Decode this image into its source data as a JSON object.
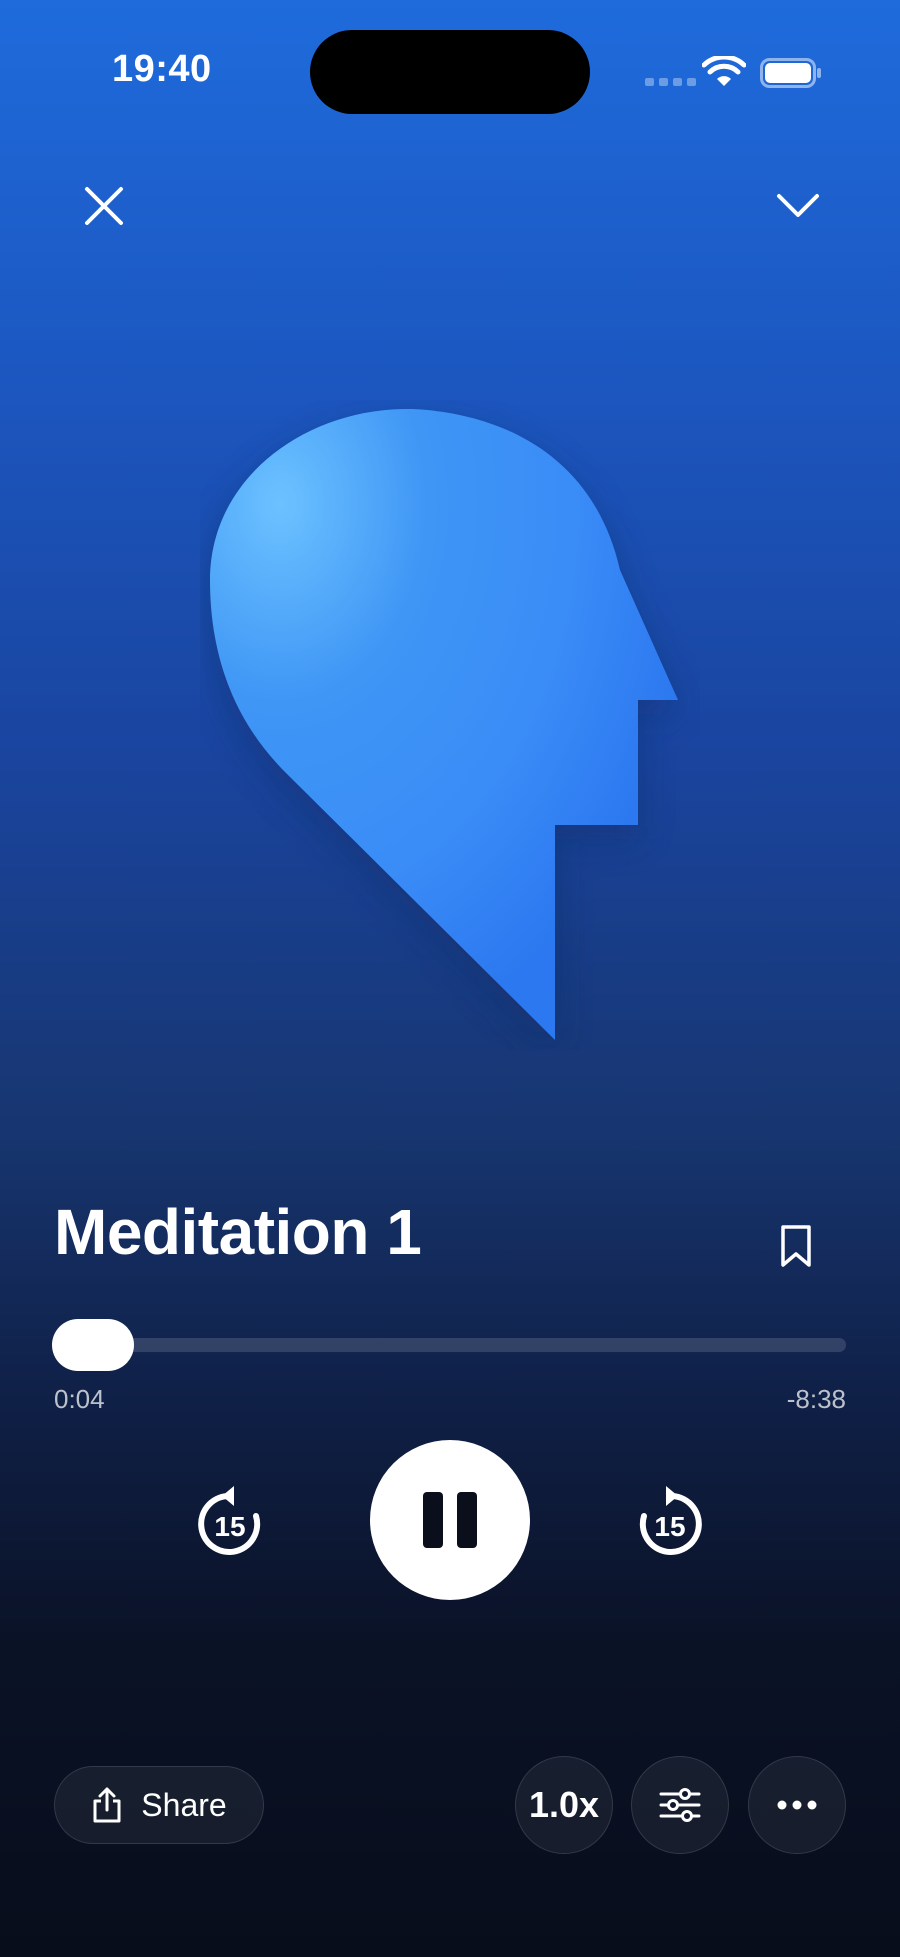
{
  "status_bar": {
    "time": "19:40"
  },
  "header": {
    "close_icon": "close-icon",
    "collapse_icon": "chevron-down-icon"
  },
  "track": {
    "title": "Meditation 1",
    "bookmarked": false
  },
  "playback": {
    "elapsed": "0:04",
    "remaining": "-8:38",
    "progress_percent": 1,
    "state": "playing",
    "skip_back_seconds": "15",
    "skip_forward_seconds": "15"
  },
  "footer": {
    "share_label": "Share",
    "speed_label": "1.0x",
    "equalizer_icon": "sliders-icon",
    "more_icon": "more-icon"
  },
  "colors": {
    "background_top": "#1f6bdc",
    "background_bottom": "#080d1b",
    "artwork_blue": "#3a8cf7",
    "artwork_light": "#6cc2ff"
  }
}
